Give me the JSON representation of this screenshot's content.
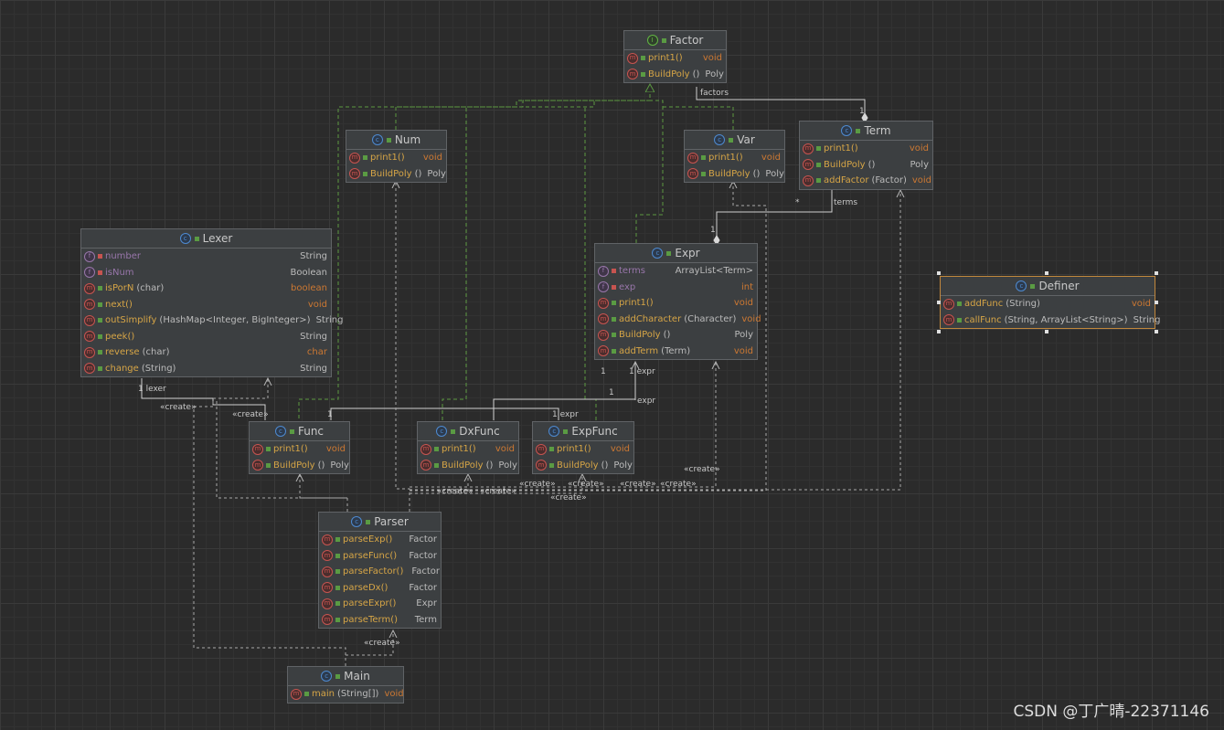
{
  "diagram": {
    "classes": {
      "factor": {
        "name": "Factor",
        "kind": "interface",
        "members": [
          {
            "name": "print1()",
            "params": "",
            "type": "void",
            "kind": "method",
            "access": "public"
          },
          {
            "name": "BuildPoly",
            "params": " ()",
            "type": "Poly",
            "kind": "method",
            "access": "public"
          }
        ]
      },
      "num": {
        "name": "Num",
        "kind": "class",
        "members": [
          {
            "name": "print1()",
            "params": "",
            "type": "void",
            "kind": "method",
            "access": "public"
          },
          {
            "name": "BuildPoly",
            "params": " ()",
            "type": "Poly",
            "kind": "method",
            "access": "public"
          }
        ]
      },
      "var": {
        "name": "Var",
        "kind": "class",
        "members": [
          {
            "name": "print1()",
            "params": "",
            "type": "void",
            "kind": "method",
            "access": "public"
          },
          {
            "name": "BuildPoly",
            "params": " ()",
            "type": "Poly",
            "kind": "method",
            "access": "public"
          }
        ]
      },
      "term": {
        "name": "Term",
        "kind": "class",
        "members": [
          {
            "name": "print1()",
            "params": "",
            "type": "void",
            "kind": "method",
            "access": "public"
          },
          {
            "name": "BuildPoly",
            "params": " ()",
            "type": "Poly",
            "kind": "method",
            "access": "public"
          },
          {
            "name": "addFactor",
            "params": "(Factor)",
            "type": "void",
            "kind": "method",
            "access": "public"
          }
        ]
      },
      "lexer": {
        "name": "Lexer",
        "kind": "class",
        "members": [
          {
            "name": "number",
            "params": "",
            "type": "String",
            "kind": "field",
            "access": "private"
          },
          {
            "name": "isNum",
            "params": "",
            "type": "Boolean",
            "kind": "field",
            "access": "private"
          },
          {
            "name": "isPorN",
            "params": "(char)",
            "type": "boolean",
            "kind": "method",
            "access": "public"
          },
          {
            "name": "next()",
            "params": "",
            "type": "void",
            "kind": "method",
            "access": "public"
          },
          {
            "name": "outSimplify",
            "params": "(HashMap<Integer, BigInteger>)",
            "type": "String",
            "kind": "method",
            "access": "public"
          },
          {
            "name": "peek()",
            "params": "",
            "type": "String",
            "kind": "method",
            "access": "public"
          },
          {
            "name": "reverse",
            "params": "(char)",
            "type": "char",
            "kind": "method",
            "access": "public"
          },
          {
            "name": "change",
            "params": "(String)",
            "type": "String",
            "kind": "method",
            "access": "public"
          }
        ]
      },
      "expr": {
        "name": "Expr",
        "kind": "class",
        "members": [
          {
            "name": "terms",
            "params": "",
            "type": "ArrayList<Term>",
            "kind": "field",
            "access": "private"
          },
          {
            "name": "exp",
            "params": "",
            "type": "int",
            "kind": "field",
            "access": "private"
          },
          {
            "name": "print1()",
            "params": "",
            "type": "void",
            "kind": "method",
            "access": "public"
          },
          {
            "name": "addCharacter",
            "params": "(Character)",
            "type": "void",
            "kind": "method",
            "access": "public"
          },
          {
            "name": "BuildPoly",
            "params": " ()",
            "type": "Poly",
            "kind": "method",
            "access": "public"
          },
          {
            "name": "addTerm",
            "params": "(Term)",
            "type": "void",
            "kind": "method",
            "access": "public"
          }
        ]
      },
      "definer": {
        "name": "Definer",
        "kind": "class",
        "members": [
          {
            "name": "addFunc",
            "params": "(String)",
            "type": "void",
            "kind": "method",
            "access": "public"
          },
          {
            "name": "callFunc",
            "params": "(String, ArrayList<String>)",
            "type": "String",
            "kind": "method",
            "access": "public"
          }
        ]
      },
      "func": {
        "name": "Func",
        "kind": "class",
        "members": [
          {
            "name": "print1()",
            "params": "",
            "type": "void",
            "kind": "method",
            "access": "public"
          },
          {
            "name": "BuildPoly",
            "params": " ()",
            "type": "Poly",
            "kind": "method",
            "access": "public"
          }
        ]
      },
      "dxfunc": {
        "name": "DxFunc",
        "kind": "class",
        "members": [
          {
            "name": "print1()",
            "params": "",
            "type": "void",
            "kind": "method",
            "access": "public"
          },
          {
            "name": "BuildPoly",
            "params": " ()",
            "type": "Poly",
            "kind": "method",
            "access": "public"
          }
        ]
      },
      "expfunc": {
        "name": "ExpFunc",
        "kind": "class",
        "members": [
          {
            "name": "print1()",
            "params": "",
            "type": "void",
            "kind": "method",
            "access": "public"
          },
          {
            "name": "BuildPoly",
            "params": " ()",
            "type": "Poly",
            "kind": "method",
            "access": "public"
          }
        ]
      },
      "parser": {
        "name": "Parser",
        "kind": "class",
        "members": [
          {
            "name": "parseExp()",
            "params": "",
            "type": "Factor",
            "kind": "method",
            "access": "public"
          },
          {
            "name": "parseFunc()",
            "params": "",
            "type": "Factor",
            "kind": "method",
            "access": "public"
          },
          {
            "name": "parseFactor()",
            "params": "",
            "type": "Factor",
            "kind": "method",
            "access": "public"
          },
          {
            "name": "parseDx()",
            "params": "",
            "type": "Factor",
            "kind": "method",
            "access": "public"
          },
          {
            "name": "parseExpr()",
            "params": "",
            "type": "Expr",
            "kind": "method",
            "access": "public"
          },
          {
            "name": "parseTerm()",
            "params": "",
            "type": "Term",
            "kind": "method",
            "access": "public"
          }
        ]
      },
      "main": {
        "name": "Main",
        "kind": "class",
        "members": [
          {
            "name": "main",
            "params": "(String[])",
            "type": "void",
            "kind": "method",
            "access": "public"
          }
        ]
      }
    },
    "relations": [
      {
        "from": "term",
        "to": "factor",
        "type": "aggregation",
        "label": "factors",
        "multiplicity_source": "1",
        "multiplicity_target": "*"
      },
      {
        "from": "expr",
        "to": "term",
        "type": "aggregation",
        "label": "terms",
        "multiplicity_source": "1",
        "multiplicity_target": "*"
      },
      {
        "from": "func",
        "to": "lexer",
        "type": "association",
        "label": "lexer",
        "multiplicity_source": "1"
      },
      {
        "from": "func",
        "to": "expr",
        "type": "association",
        "label": "expr",
        "multiplicity_source": "1"
      },
      {
        "from": "dxfunc",
        "to": "expr",
        "type": "association",
        "label": "expr",
        "multiplicity_source": "1"
      },
      {
        "from": "expfunc",
        "to": "expr",
        "type": "association",
        "label": "expr",
        "multiplicity_source": "1"
      },
      {
        "from": "num",
        "to": "factor",
        "type": "realization"
      },
      {
        "from": "var",
        "to": "factor",
        "type": "realization"
      },
      {
        "from": "expr",
        "to": "factor",
        "type": "realization"
      },
      {
        "from": "func",
        "to": "factor",
        "type": "realization"
      },
      {
        "from": "dxfunc",
        "to": "factor",
        "type": "realization"
      },
      {
        "from": "expfunc",
        "to": "factor",
        "type": "realization"
      },
      {
        "from": "parser",
        "to": "func",
        "type": "dependency",
        "label": "«create»"
      },
      {
        "from": "parser",
        "to": "dxfunc",
        "type": "dependency",
        "label": "«create»"
      },
      {
        "from": "parser",
        "to": "expfunc",
        "type": "dependency",
        "label": "«create»"
      },
      {
        "from": "parser",
        "to": "num",
        "type": "dependency",
        "label": "«create»"
      },
      {
        "from": "parser",
        "to": "var",
        "type": "dependency",
        "label": "«create»"
      },
      {
        "from": "parser",
        "to": "expr",
        "type": "dependency",
        "label": "«create»"
      },
      {
        "from": "parser",
        "to": "term",
        "type": "dependency",
        "label": "«create»"
      },
      {
        "from": "main",
        "to": "lexer",
        "type": "dependency",
        "label": "«create»"
      },
      {
        "from": "main",
        "to": "parser",
        "type": "dependency",
        "label": "«create»"
      }
    ],
    "edge_labels": [
      {
        "id": "factors",
        "text": "factors"
      },
      {
        "id": "m-term-1",
        "text": "1"
      },
      {
        "id": "m-term-star",
        "text": "*"
      },
      {
        "id": "terms",
        "text": "terms"
      },
      {
        "id": "m-expr-1",
        "text": "1"
      },
      {
        "id": "lexer-1",
        "text": "1 lexer"
      },
      {
        "id": "cr-lexer",
        "text": "«create»"
      },
      {
        "id": "cr-lexer2",
        "text": "«create»"
      },
      {
        "id": "m-func-1",
        "text": "1"
      },
      {
        "id": "m-expr-left-1",
        "text": "1"
      },
      {
        "id": "m-expr-expr",
        "text": "1 expr"
      },
      {
        "id": "m-1-mid",
        "text": "1"
      },
      {
        "id": "lbl-expr-mid",
        "text": "expr"
      },
      {
        "id": "m-expfunc-1",
        "text": "1 expr"
      },
      {
        "id": "cr-1",
        "text": "«create»"
      },
      {
        "id": "cr-2",
        "text": "«create»"
      },
      {
        "id": "cr-3",
        "text": "«create»"
      },
      {
        "id": "cr-4",
        "text": "«create»"
      },
      {
        "id": "cr-5",
        "text": "«create»"
      },
      {
        "id": "cr-6",
        "text": "«create»"
      },
      {
        "id": "cr-7",
        "text": "«create»"
      },
      {
        "id": "cr-8",
        "text": "«create»"
      },
      {
        "id": "cr-9",
        "text": "«create»"
      }
    ]
  },
  "watermark": "CSDN @丁广晴-22371146",
  "colors": {
    "background": "#2b2b2b",
    "class_fill": "#3c3f41",
    "realization_line": "#5c9a42",
    "association_line": "#cfcfcf",
    "dependency_line": "#a8a8a8",
    "method_name": "#d6a546",
    "field_name": "#9876aa",
    "keyword_type": "#cc7832",
    "selected_border": "#c1873c"
  }
}
